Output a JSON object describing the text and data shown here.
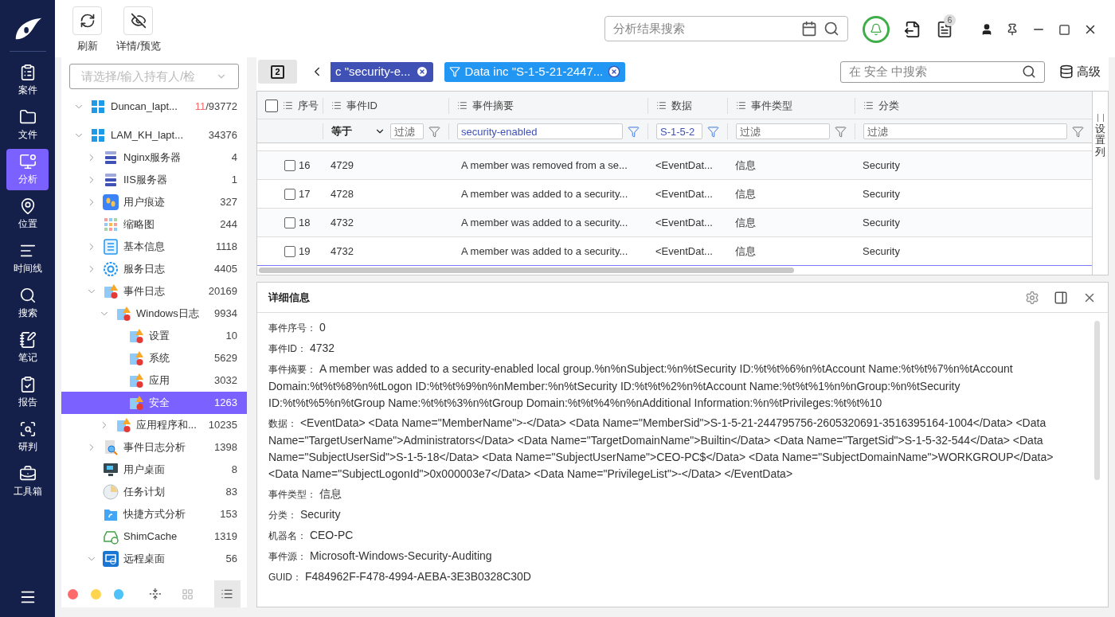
{
  "nav": {
    "items": [
      {
        "label": "案件",
        "selected": false
      },
      {
        "label": "文件",
        "selected": false
      },
      {
        "label": "分析",
        "selected": true
      },
      {
        "label": "位置",
        "selected": false
      },
      {
        "label": "时间线",
        "selected": false
      },
      {
        "label": "搜索",
        "selected": false
      },
      {
        "label": "笔记",
        "selected": false
      },
      {
        "label": "报告",
        "selected": false
      },
      {
        "label": "研判",
        "selected": false
      },
      {
        "label": "工具箱",
        "selected": false
      }
    ]
  },
  "toolbar": {
    "buttons": [
      {
        "label": "刷新"
      },
      {
        "label": "详情/预览"
      }
    ],
    "search": {
      "placeholder": "分析结果搜索"
    },
    "badge": "6"
  },
  "tree": {
    "owner_select": {
      "placeholder": "请选择/输入持有人/检"
    },
    "items": [
      {
        "label": "Duncan_lapt...",
        "flagged": "11",
        "count": "/93772",
        "kind": "windows",
        "expanded": true,
        "selected": false
      },
      {
        "label": "LAM_KH_lapt...",
        "count": "34376",
        "kind": "windows",
        "expanded": true,
        "selected": false,
        "children": [
          {
            "label": "Nginx服务器",
            "count": "4",
            "kind": "server",
            "expanded": false,
            "selected": false
          },
          {
            "label": "IIS服务器",
            "count": "1",
            "kind": "server",
            "expanded": false,
            "selected": false
          },
          {
            "label": "用户痕迹",
            "count": "327",
            "kind": "footprints",
            "expanded": false,
            "selected": false
          },
          {
            "label": "缩略图",
            "count": "244",
            "kind": "thumbs",
            "selected": false
          },
          {
            "label": "基本信息",
            "count": "1118",
            "kind": "list",
            "expanded": false,
            "selected": false
          },
          {
            "label": "服务日志",
            "count": "4405",
            "kind": "service",
            "expanded": false,
            "selected": false
          },
          {
            "label": "事件日志",
            "count": "20169",
            "kind": "eventlog",
            "expanded": true,
            "selected": false,
            "children": [
              {
                "label": "Windows日志",
                "count": "9934",
                "kind": "eventlog",
                "expanded": true,
                "selected": false,
                "children": [
                  {
                    "label": "设置",
                    "count": "10",
                    "kind": "eventlog",
                    "selected": false
                  },
                  {
                    "label": "系统",
                    "count": "5629",
                    "kind": "eventlog",
                    "selected": false
                  },
                  {
                    "label": "应用",
                    "count": "3032",
                    "kind": "eventlog",
                    "selected": false
                  },
                  {
                    "label": "安全",
                    "count": "1263",
                    "kind": "eventlog",
                    "selected": true
                  }
                ]
              },
              {
                "label": "应用程序和...",
                "count": "10235",
                "kind": "eventlog",
                "expanded": false,
                "selected": false
              }
            ]
          },
          {
            "label": "事件日志分析",
            "count": "1398",
            "kind": "docsearch",
            "expanded": false,
            "selected": false
          },
          {
            "label": "用户桌面",
            "count": "8",
            "kind": "monitor",
            "selected": false
          },
          {
            "label": "任务计划",
            "count": "83",
            "kind": "clock",
            "selected": false
          },
          {
            "label": "快捷方式分析",
            "count": "153",
            "kind": "folder",
            "selected": false
          },
          {
            "label": "ShimCache",
            "count": "1319",
            "kind": "cache",
            "selected": false
          },
          {
            "label": "远程桌面",
            "count": "56",
            "kind": "remote",
            "expanded": true,
            "selected": false
          }
        ]
      }
    ],
    "swatches": [
      {
        "color": "#ff6b6b"
      },
      {
        "color": "#ffd54f"
      },
      {
        "color": "#4fc3f7"
      }
    ],
    "views": [
      {
        "kind": "grid",
        "selected": false
      },
      {
        "kind": "list",
        "selected": true
      }
    ]
  },
  "filters": {
    "count": "2",
    "chips": [
      {
        "label": "c \"security-e...",
        "color": "#3f51b5"
      },
      {
        "label": "Data inc \"S-1-5-21-2447...",
        "color": "#2196f3"
      }
    ],
    "search": {
      "placeholder": "在 安全 中搜索"
    },
    "advanced": "高级"
  },
  "table": {
    "select_all": {
      "checked": false
    },
    "columns": [
      {
        "label": "序号"
      },
      {
        "label": "事件ID",
        "filter": {
          "operator": "等于",
          "placeholder": "过滤",
          "active": false
        }
      },
      {
        "label": "事件摘要",
        "filter": {
          "value": "security-enabled",
          "active": true
        }
      },
      {
        "label": "数据",
        "filter": {
          "value": "S-1-5-2",
          "active": true
        }
      },
      {
        "label": "事件类型",
        "filter": {
          "placeholder": "过滤",
          "active": false
        }
      },
      {
        "label": "分类",
        "filter": {
          "placeholder": "过滤",
          "active": false
        }
      }
    ],
    "rows": [
      {
        "checked": false,
        "focused": false,
        "cells": [
          "16",
          "4729",
          "A member was removed from a se...",
          "<EventDat...",
          "信息",
          "Security"
        ]
      },
      {
        "checked": false,
        "focused": false,
        "cells": [
          "17",
          "4728",
          "A member was added to a security...",
          "<EventDat...",
          "信息",
          "Security"
        ]
      },
      {
        "checked": false,
        "focused": false,
        "cells": [
          "18",
          "4732",
          "A member was added to a security...",
          "<EventDat...",
          "信息",
          "Security"
        ]
      },
      {
        "checked": false,
        "focused": true,
        "cells": [
          "19",
          "4732",
          "A member was added to a security...",
          "<EventDat...",
          "信息",
          "Security"
        ]
      }
    ],
    "column_settings": "设置列"
  },
  "details": {
    "title": "详细信息",
    "fields": [
      {
        "label": "事件序号：",
        "value": "0"
      },
      {
        "label": "事件ID：",
        "value": "4732"
      },
      {
        "label": "事件摘要：",
        "value": "A member was added to a security-enabled local group.%n%nSubject:%n%tSecurity ID:%t%t%6%n%tAccount Name:%t%t%7%n%tAccount Domain:%t%t%8%n%tLogon ID:%t%t%9%n%nMember:%n%tSecurity ID:%t%t%2%n%tAccount Name:%t%t%1%n%nGroup:%n%tSecurity ID:%t%t%5%n%tGroup Name:%t%t%3%n%tGroup Domain:%t%t%4%n%nAdditional Information:%n%tPrivileges:%t%t%10"
      },
      {
        "label": "数据：",
        "value": "<EventData> <Data Name=\"MemberName\">-</Data> <Data Name=\"MemberSid\">S-1-5-21-244795756-2605320691-3516395164-1004</Data> <Data Name=\"TargetUserName\">Administrators</Data> <Data Name=\"TargetDomainName\">Builtin</Data> <Data Name=\"TargetSid\">S-1-5-32-544</Data> <Data Name=\"SubjectUserSid\">S-1-5-18</Data> <Data Name=\"SubjectUserName\">CEO-PC$</Data> <Data Name=\"SubjectDomainName\">WORKGROUP</Data> <Data Name=\"SubjectLogonId\">0x000003e7</Data> <Data Name=\"PrivilegeList\">-</Data> </EventData>"
      },
      {
        "label": "事件类型：",
        "value": "信息"
      },
      {
        "label": "分类：",
        "value": "Security"
      },
      {
        "label": "机器名：",
        "value": "CEO-PC"
      },
      {
        "label": "事件源：",
        "value": "Microsoft-Windows-Security-Auditing"
      },
      {
        "label": "GUID：",
        "value": "F484962F-F478-4994-AEBA-3E3B0328C30D"
      }
    ]
  }
}
